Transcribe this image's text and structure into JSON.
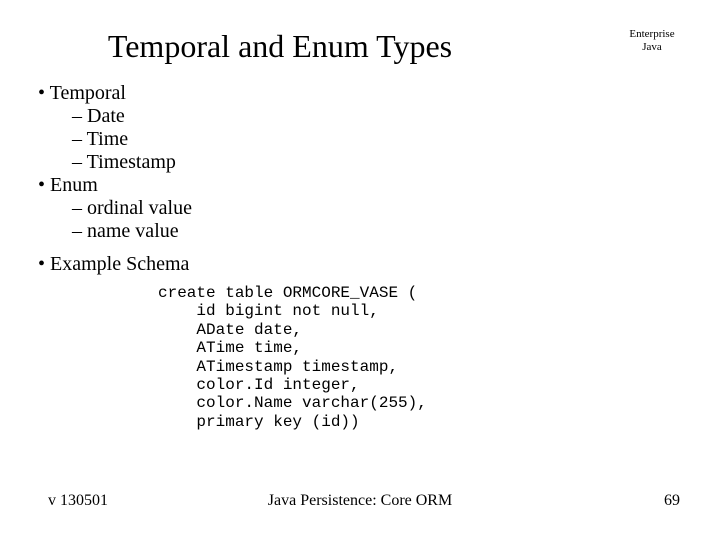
{
  "title": "Temporal and Enum Types",
  "corner": {
    "line1": "Enterprise",
    "line2": "Java"
  },
  "bullets": {
    "b1": {
      "label": "Temporal",
      "items": [
        "Date",
        "Time",
        "Timestamp"
      ]
    },
    "b2": {
      "label": "Enum",
      "items": [
        "ordinal value",
        "name value"
      ]
    },
    "b3": {
      "label": "Example Schema"
    }
  },
  "code": "create table ORMCORE_VASE (\n    id bigint not null,\n    ADate date,\n    ATime time,\n    ATimestamp timestamp,\n    color.Id integer,\n    color.Name varchar(255),\n    primary key (id))",
  "footer": {
    "left": "v 130501",
    "center": "Java Persistence: Core ORM",
    "right": "69"
  }
}
